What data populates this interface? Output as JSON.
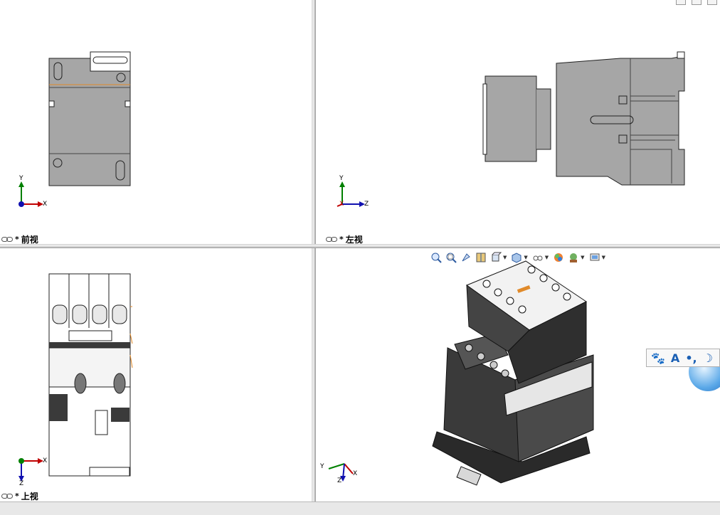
{
  "views": {
    "front": {
      "label": "前视",
      "star": "*",
      "axes": {
        "y": "Y",
        "x": "X"
      }
    },
    "left": {
      "label": "左视",
      "star": "*",
      "axes": {
        "y": "Y",
        "x": "X",
        "z": "Z"
      }
    },
    "top": {
      "label": "上视",
      "star": "*",
      "axes": {
        "x": "X",
        "z": "Z"
      }
    },
    "iso": {
      "axes": {
        "y": "Y",
        "x": "X",
        "z": "Z"
      }
    }
  },
  "heads_up_toolbar": {
    "items": [
      "zoom-to-fit-icon",
      "zoom-to-area-icon",
      "previous-view-icon",
      "section-view-icon",
      "view-orientation-icon",
      "display-style-icon",
      "hide-show-items-icon",
      "edit-appearance-icon",
      "apply-scene-icon",
      "view-settings-icon"
    ]
  },
  "ime_bar": {
    "items": [
      "paw-icon",
      "A",
      "•,",
      "moon-icon"
    ]
  },
  "colors": {
    "part_gray": "#a6a6a6",
    "part_dark": "#3a3a3a",
    "edge_orange": "#e08a2a",
    "axis_red": "#c00000",
    "axis_green": "#008000",
    "axis_blue": "#1010b0"
  }
}
